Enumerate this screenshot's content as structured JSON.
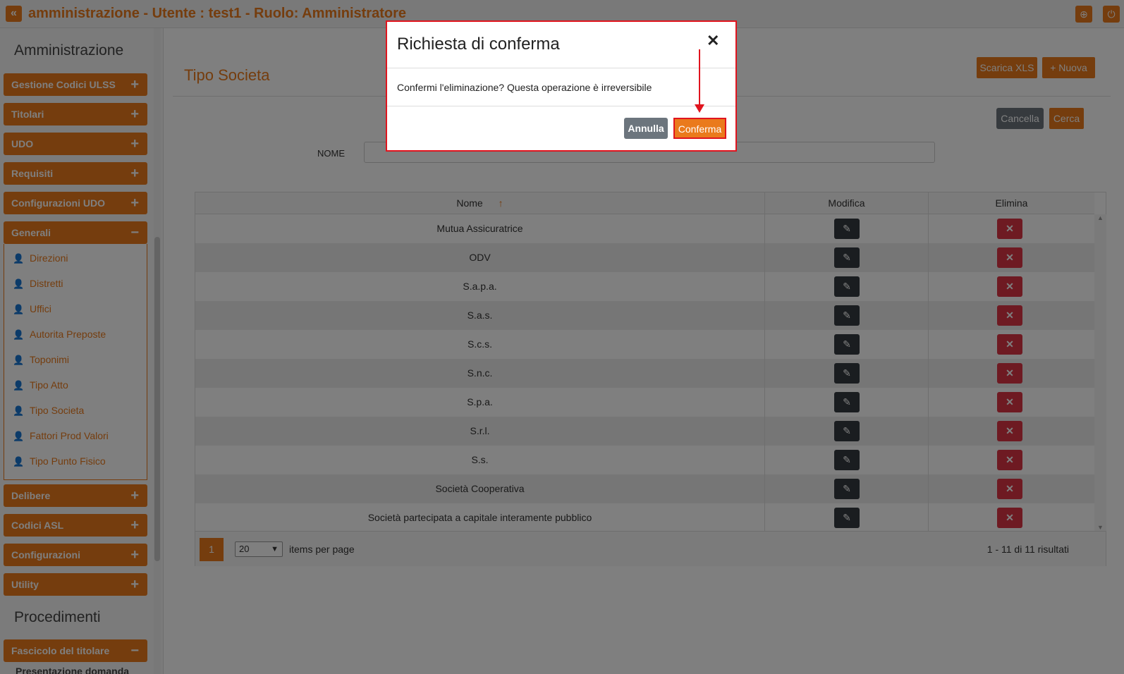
{
  "topbar": {
    "title": "amministrazione - Utente : test1 - Ruolo: Amministratore",
    "back_icon": "«",
    "globe_icon": "⊕",
    "power_icon": "⏻"
  },
  "sidebar": {
    "heading_admin": "Amministrazione",
    "heading_proc": "Procedimenti",
    "groups": [
      {
        "label": "Gestione Codici ULSS",
        "state": "+"
      },
      {
        "label": "Titolari",
        "state": "+"
      },
      {
        "label": "UDO",
        "state": "+"
      },
      {
        "label": "Requisiti",
        "state": "+"
      },
      {
        "label": "Configurazioni UDO",
        "state": "+"
      },
      {
        "label": "Generali",
        "state": "−"
      },
      {
        "label": "Delibere",
        "state": "+"
      },
      {
        "label": "Codici ASL",
        "state": "+"
      },
      {
        "label": "Configurazioni",
        "state": "+"
      },
      {
        "label": "Utility",
        "state": "+"
      },
      {
        "label": "Fascicolo del titolare",
        "state": "−"
      }
    ],
    "generali_items": [
      "Direzioni",
      "Distretti",
      "Uffici",
      "Autorita Preposte",
      "Toponimi",
      "Tipo Atto",
      "Tipo Societa",
      "Fattori Prod Valori",
      "Tipo Punto Fisico"
    ],
    "fascicolo_item": "Presentazione domanda"
  },
  "main": {
    "title": "Tipo Societa",
    "download_label": "Scarica XLS",
    "new_label": "+ Nuova",
    "cancel_label": "Cancella",
    "search_label": "Cerca",
    "nome_label": "NOME",
    "nome_value": ""
  },
  "grid": {
    "headers": {
      "nome": "Nome",
      "sort": "↑",
      "modifica": "Modifica",
      "elimina": "Elimina"
    },
    "rows": [
      "Mutua Assicuratrice",
      "ODV",
      "S.a.p.a.",
      "S.a.s.",
      "S.c.s.",
      "S.n.c.",
      "S.p.a.",
      "S.r.l.",
      "S.s.",
      "Società Cooperativa",
      "Società partecipata a capitale interamente pubblico"
    ],
    "edit_icon": "✎",
    "delete_icon": "✕",
    "page": "1",
    "page_size": "20",
    "items_per_page": "items per page",
    "results": "1 - 11 di 11 risultati"
  },
  "modal": {
    "title": "Richiesta di conferma",
    "close": "✕",
    "body": "Confermi l'eliminazione? Questa operazione è irreversibile",
    "cancel": "Annulla",
    "confirm": "Conferma"
  },
  "colors": {
    "accent": "#ea7a1c",
    "danger": "#dc3545",
    "highlight": "#e0141e"
  }
}
